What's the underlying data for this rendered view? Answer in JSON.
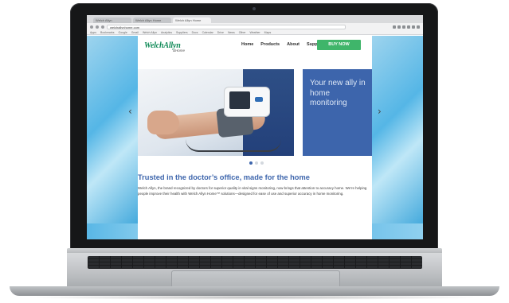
{
  "browser": {
    "tabs": [
      {
        "label": "Welch Allyn"
      },
      {
        "label": "Welch Allyn Home"
      },
      {
        "label": "Welch Allyn Home"
      }
    ],
    "url": "welchallynhome.com",
    "bookmarks": [
      "Apps",
      "Bookmarks",
      "Google",
      "Gmail",
      "Welch Allyn",
      "Analytics",
      "Suppliers",
      "Docs",
      "Calendar",
      "Drive",
      "News",
      "Other",
      "Weather",
      "Maps",
      "Photos",
      "Sites"
    ]
  },
  "site": {
    "logo": "WelchAllyn",
    "logo_sub": "&Home",
    "nav": [
      "Home",
      "Products",
      "About",
      "Support"
    ],
    "buy_button": "BUY NOW",
    "hero": {
      "tagline": "Your new ally in home monitoring"
    },
    "carousel": {
      "prev": "‹",
      "next": "›",
      "dots": 3,
      "active_dot": 1
    },
    "headline": "Trusted in the doctor’s office, made for the home",
    "body": "Welch Allyn, the brand recognized by doctors for superior quality in vital signs monitoring, now brings that attention to accuracy home. We’re helping people improve their health with Welch Allyn Home™ solutions—designed for ease of use and superior accuracy in home monitoring."
  },
  "colors": {
    "brand_green": "#0f8a57",
    "buy_green": "#3fb56a",
    "brand_blue": "#3d65ac"
  }
}
